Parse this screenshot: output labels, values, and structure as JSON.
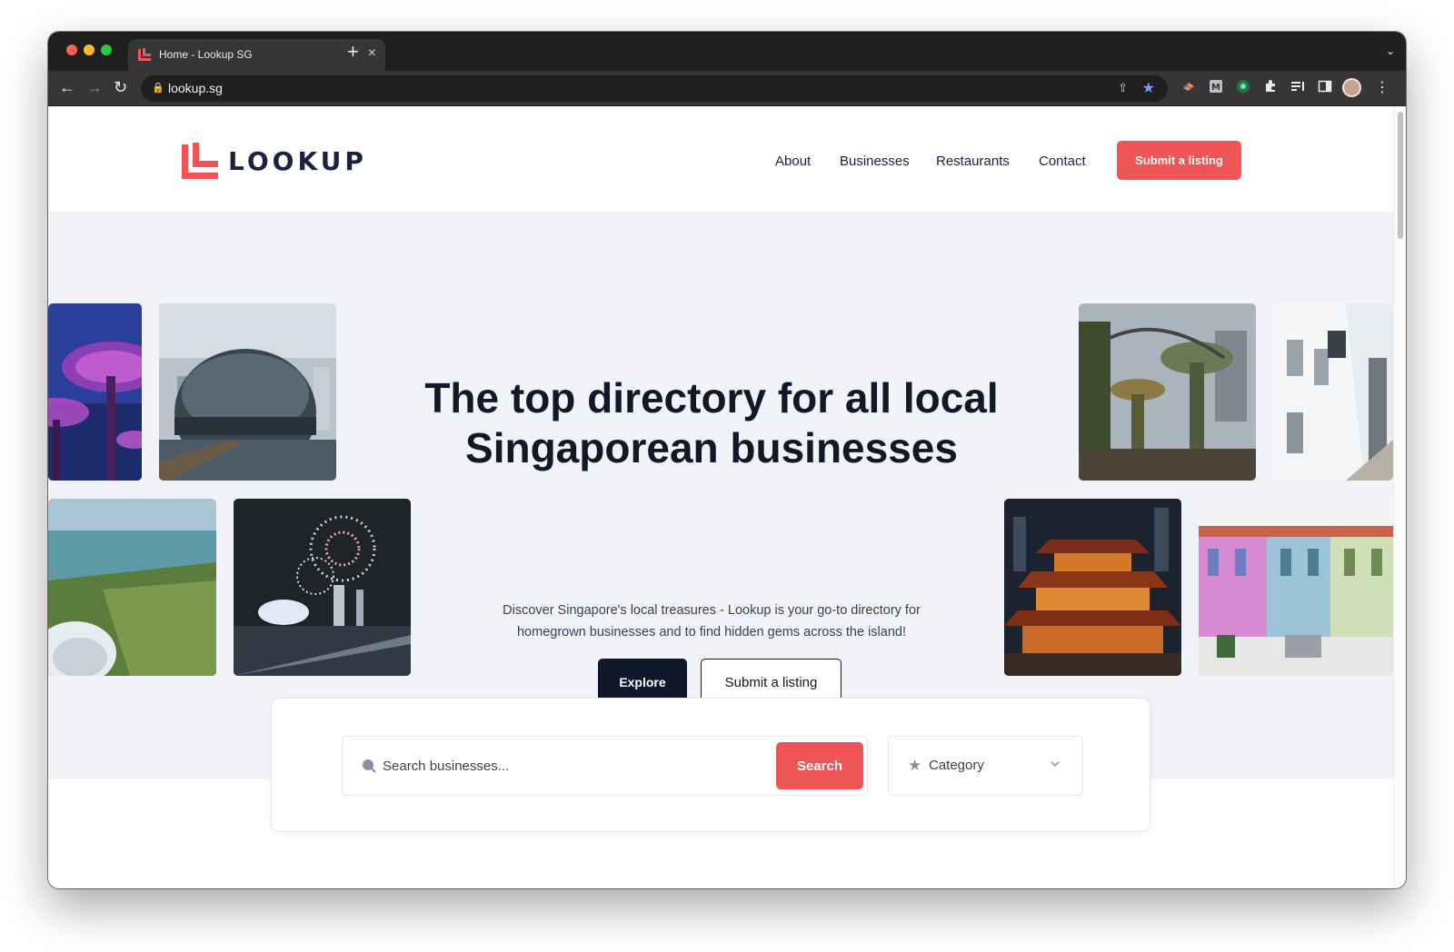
{
  "browser": {
    "tab_title": "Home - Lookup SG",
    "tab_close": "×",
    "new_tab": "+",
    "url": "lookup.sg"
  },
  "site": {
    "brand": "LOOKUP",
    "accent_color": "#ef5456",
    "dark_color": "#0f172a",
    "nav": [
      {
        "label": "About"
      },
      {
        "label": "Businesses"
      },
      {
        "label": "Restaurants"
      },
      {
        "label": "Contact"
      }
    ],
    "header_cta": "Submit a listing"
  },
  "hero": {
    "title_line1": "The top directory for all local",
    "title_line2": "Singaporean businesses",
    "subtitle_line1": "Discover Singapore's local treasures - Lookup is your go-to directory for",
    "subtitle_line2": "homegrown businesses and to find hidden gems across the island!",
    "explore_label": "Explore",
    "submit_label": "Submit a listing"
  },
  "search": {
    "placeholder": "Search businesses...",
    "button_label": "Search",
    "category_label": "Category"
  }
}
